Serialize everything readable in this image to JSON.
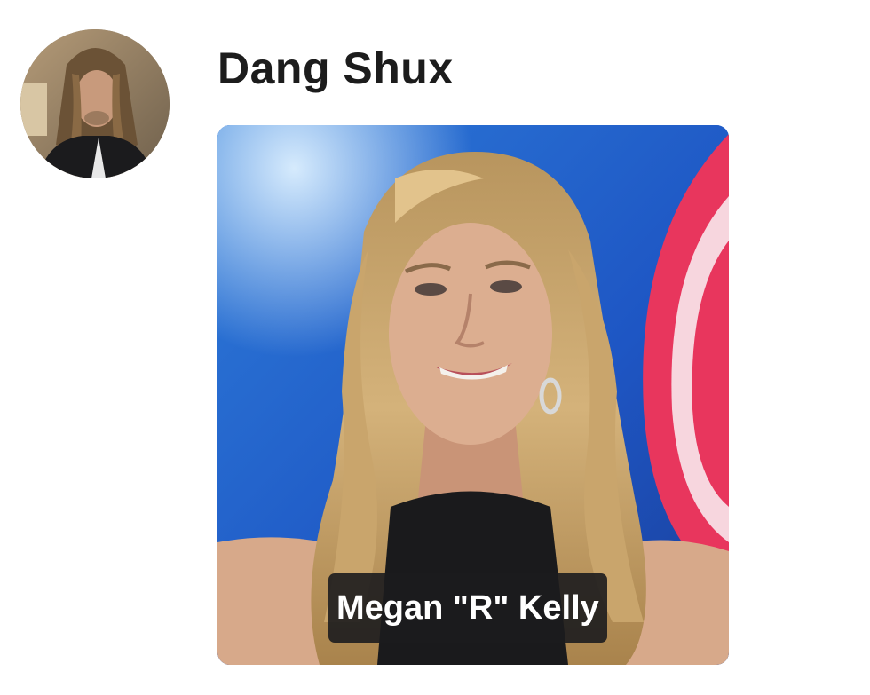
{
  "post": {
    "author_name": "Dang Shux",
    "avatar_icon": "profile-photo",
    "image": {
      "icon": "portrait-photo",
      "caption": "Megan \"R\" Kelly"
    }
  },
  "colors": {
    "text": "#1c1c1c",
    "caption_bg": "#1c1c1e",
    "caption_text": "#ffffff",
    "photo_background": "#1f5fc9",
    "photo_accent": "#e8365d"
  }
}
